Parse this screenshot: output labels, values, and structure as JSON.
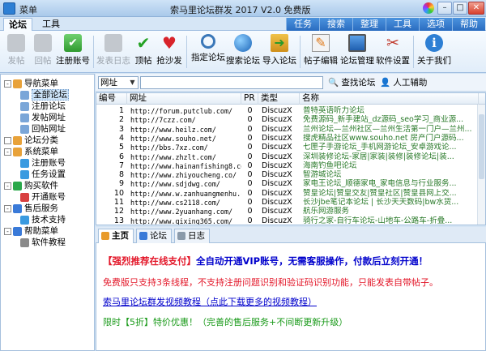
{
  "window": {
    "menu_label": "菜单",
    "title": "索马里论坛群发 2017 V2.0 免费版"
  },
  "tabs": {
    "left": [
      "论坛",
      "工具"
    ],
    "right": [
      "任务",
      "搜索",
      "整理",
      "工具",
      "选项",
      "帮助"
    ]
  },
  "toolbar": [
    {
      "label": "发帖",
      "icon": "post-icon",
      "enabled": false
    },
    {
      "label": "回帖",
      "icon": "reply-icon",
      "enabled": false
    },
    {
      "label": "注册账号",
      "icon": "register-icon",
      "enabled": true
    },
    {
      "label": "发表日志",
      "icon": "blog-icon",
      "enabled": false
    },
    {
      "label": "顶帖",
      "icon": "check-icon",
      "enabled": true
    },
    {
      "label": "抢沙发",
      "icon": "heart-icon",
      "enabled": true
    },
    {
      "label": "指定论坛",
      "icon": "search-icon",
      "enabled": true
    },
    {
      "label": "搜索论坛",
      "icon": "globe-icon",
      "enabled": true
    },
    {
      "label": "导入论坛",
      "icon": "import-icon",
      "enabled": true
    },
    {
      "label": "帖子编辑",
      "icon": "edit-icon",
      "enabled": true
    },
    {
      "label": "论坛管理",
      "icon": "monitor-icon",
      "enabled": true
    },
    {
      "label": "软件设置",
      "icon": "tools-icon",
      "enabled": true
    },
    {
      "label": "关于我们",
      "icon": "info-icon",
      "enabled": true
    }
  ],
  "tree": [
    {
      "label": "导航菜单",
      "level": 0,
      "toggle": "-",
      "icon_color": "#e8a23a"
    },
    {
      "label": "全部论坛",
      "level": 1,
      "icon_color": "#7aa6d8",
      "selected": true
    },
    {
      "label": "注册论坛",
      "level": 1,
      "icon_color": "#7aa6d8"
    },
    {
      "label": "发帖网址",
      "level": 1,
      "icon_color": "#7aa6d8"
    },
    {
      "label": "回帖网址",
      "level": 1,
      "icon_color": "#7aa6d8"
    },
    {
      "label": "论坛分类",
      "level": 0,
      "toggle": "",
      "icon_color": "#e8a23a"
    },
    {
      "label": "系统菜单",
      "level": 0,
      "toggle": "-",
      "icon_color": "#e8a23a"
    },
    {
      "label": "注册账号",
      "level": 1,
      "icon_color": "#3a9ae0"
    },
    {
      "label": "任务设置",
      "level": 1,
      "icon_color": "#3a9ae0"
    },
    {
      "label": "购买软件",
      "level": 0,
      "toggle": "-",
      "icon_color": "#2aa84a"
    },
    {
      "label": "开通账号",
      "level": 1,
      "icon_color": "#d84040"
    },
    {
      "label": "售后服务",
      "level": 0,
      "toggle": "-",
      "icon_color": "#3a7ad8"
    },
    {
      "label": "技术支持",
      "level": 1,
      "icon_color": "#3a9ae0"
    },
    {
      "label": "帮助菜单",
      "level": 0,
      "toggle": "-",
      "icon_color": "#3a7ad8"
    },
    {
      "label": "软件教程",
      "level": 1,
      "icon_color": "#8a8a8a"
    }
  ],
  "search": {
    "select_value": "网址",
    "input_value": "",
    "search_label": "查找论坛",
    "human_label": "人工辅助"
  },
  "table": {
    "headers": [
      "编号",
      "网址",
      "PR",
      "类型",
      "名称"
    ],
    "rows": [
      [
        "1",
        "http://forum.putclub.com/",
        "0",
        "DiscuzX",
        "普特英语听力论坛"
      ],
      [
        "2",
        "http://7czz.com/",
        "0",
        "DiscuzX",
        "免费源码_新手建站_dz源码_seo学习_商业源..."
      ],
      [
        "3",
        "http://www.heilz.com/",
        "0",
        "DiscuzX",
        "兰州论坛—兰州社区—兰州生活第一门户—兰州..."
      ],
      [
        "4",
        "http://www.souho.net/",
        "0",
        "DiscuzX",
        "搜虎精品社区www.souho.net 房产门户源码..."
      ],
      [
        "5",
        "http://bbs.7xz.com/",
        "0",
        "DiscuzX",
        "七匣子手游论坛_手机网游论坛_安卓游戏论..."
      ],
      [
        "6",
        "http://www.zhzlt.com/",
        "0",
        "DiscuzX",
        "深圳装修论坛-家居|家装|装修|装修论坛|装..."
      ],
      [
        "7",
        "http://www.hainanfishing8.com/",
        "0",
        "DiscuzX",
        "海南钓鱼吧论坛"
      ],
      [
        "8",
        "http://www.zhiyoucheng.co/",
        "0",
        "DiscuzX",
        "智游城论坛"
      ],
      [
        "9",
        "http://www.sdjdwg.com/",
        "0",
        "DiscuzX",
        "家电王论坛_顺德家电_家电信息与行业服务..."
      ],
      [
        "10",
        "http://www.w.zanhuangmenhu.cn/",
        "0",
        "DiscuzX",
        "赞皇论坛|赞皇交友|赞皇社区|赞皇县网上交..."
      ],
      [
        "11",
        "http://www.cs2118.com/",
        "0",
        "DiscuzX",
        "长沙jbe笔记本论坛 | 长沙天天数码|bw水货..."
      ],
      [
        "12",
        "http://www.2yuanhang.com/",
        "0",
        "DiscuzX",
        "航乐网游服务"
      ],
      [
        "13",
        "http://www.qixing365.com/",
        "0",
        "DiscuzX",
        "骑行之家-自行车论坛-山地车-公路车-折叠..."
      ]
    ]
  },
  "bottom_tabs": [
    "主页",
    "论坛",
    "日志"
  ],
  "content": {
    "line1_red": "【强烈推荐在线支付】",
    "line1_blue": "全自动开通VIP账号，无需客服操作，付款后立刻开通！",
    "line2": "免费版只支持3条线程，不支持注册问题识别和验证码识别功能，只能发表自带帖子。",
    "line3": "索马里论坛群发视频教程（点此下载更多的视频教程）",
    "line4": "限时【5折】特价优惠！（完善的售后服务+不间断更新升级）"
  },
  "colors": {
    "accent_blue": "#2a6cc0",
    "promo_red": "#e3182a",
    "promo_blue": "#0000cc",
    "promo_green": "#1a9a1a",
    "site_name_green": "#2a7a2a"
  }
}
